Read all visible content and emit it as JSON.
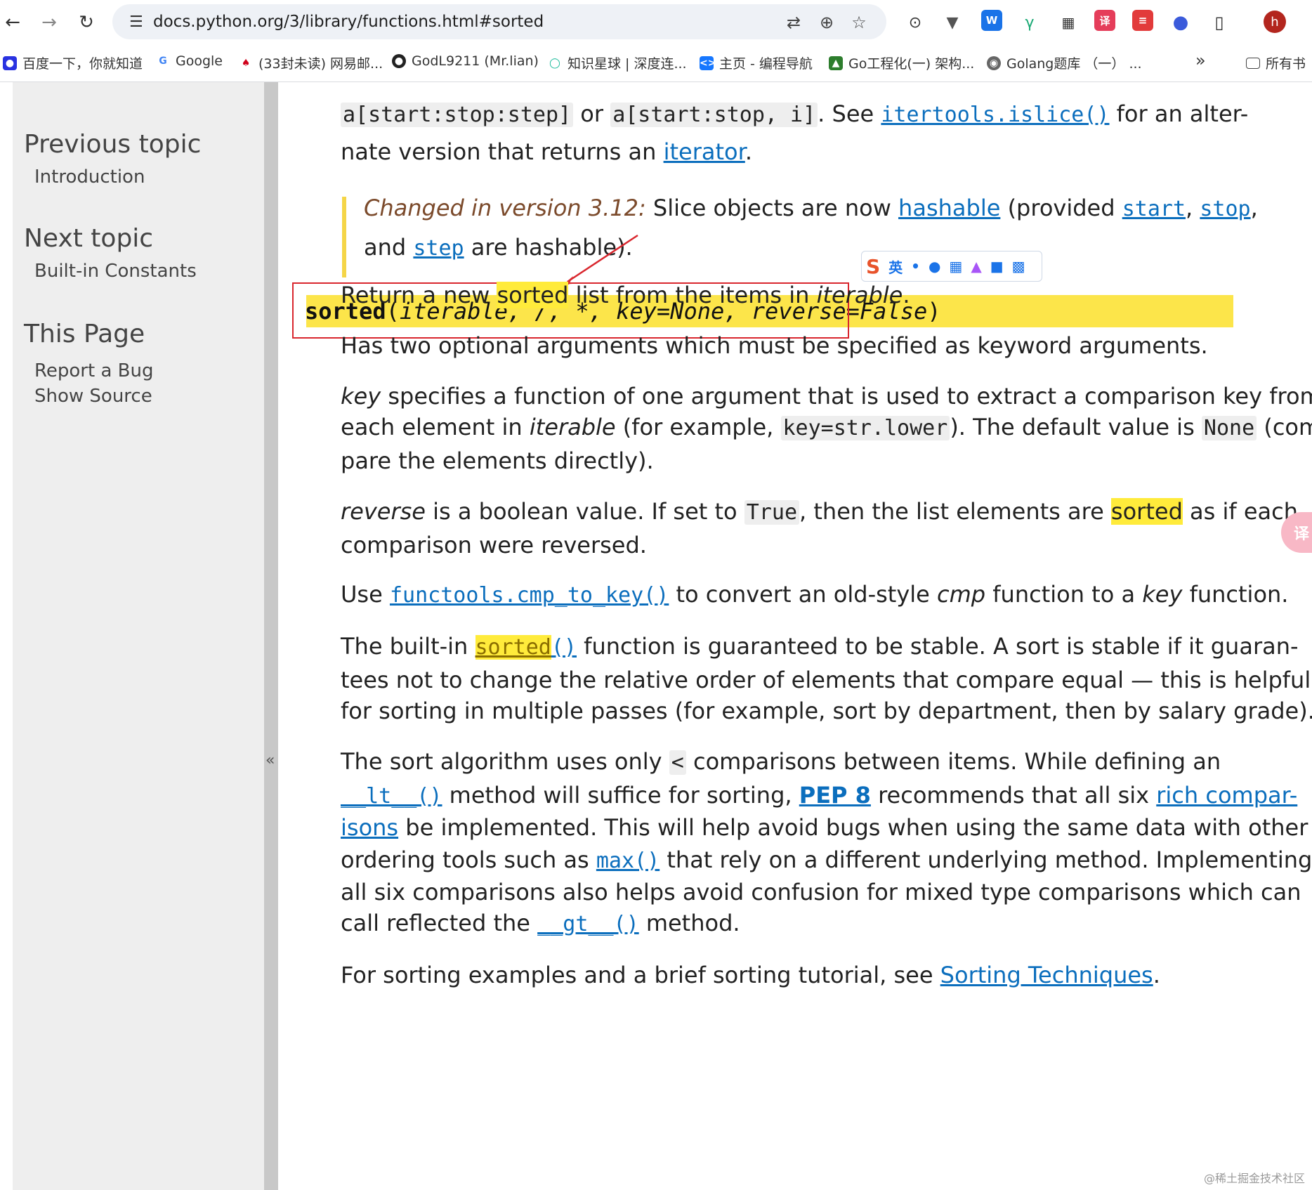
{
  "browser": {
    "url": "docs.python.org/3/library/functions.html#sorted",
    "avatar": "h",
    "ext_labels": [
      "W",
      "译",
      "≡"
    ]
  },
  "bookmarks": [
    {
      "label": "百度一下，你就知道",
      "icon": "baidu-icon",
      "color": "#2932e1"
    },
    {
      "label": "Google",
      "icon": "google-icon",
      "color": "#4285f4"
    },
    {
      "label": "(33封未读) 网易邮...",
      "icon": "netease-mail-icon",
      "color": "#d0021b"
    },
    {
      "label": "GodL9211 (Mr.lian)",
      "icon": "github-icon",
      "color": "#222222"
    },
    {
      "label": "知识星球 | 深度连...",
      "icon": "zsxq-icon",
      "color": "#16b998"
    },
    {
      "label": "主页 - 编程导航",
      "icon": "code-nav-icon",
      "color": "#1677ff"
    },
    {
      "label": "Go工程化(一) 架构...",
      "icon": "go-icon",
      "color": "#2d7d2d"
    },
    {
      "label": "Golang题库 （一） ...",
      "icon": "globe-icon",
      "color": "#666666"
    }
  ],
  "bookmarks_more": "»",
  "bookmarks_all": "所有书",
  "sidebar": {
    "prev_title": "Previous topic",
    "prev_link": "Introduction",
    "next_title": "Next topic",
    "next_link": "Built-in Constants",
    "page_title": "This Page",
    "report_bug": "Report a Bug",
    "show_source": "Show Source",
    "collapse": "«"
  },
  "doc": {
    "slice_a1": "a[start:stop:step]",
    "slice_or": " or ",
    "slice_a2": "a[start:stop, i]",
    "slice_see": ". See ",
    "slice_islice": "itertools.islice()",
    "slice_tail": " for an alter-",
    "slice2_pre": "nate version that returns an ",
    "slice2_link": "iterator",
    "slice2_post": ".",
    "changed_label": "Changed in version 3.12:",
    "changed_pre": " Slice objects are now ",
    "changed_hashable": "hashable",
    "changed_mid": " (provided ",
    "changed_start": "start",
    "changed_comma": ", ",
    "changed_stop": "stop",
    "changed_comma2": ",",
    "changed2_pre": "and ",
    "changed2_step": "step",
    "changed2_post": " are hashable).",
    "sig_name": "sorted",
    "sig_open": "(",
    "sig_params": "iterable, /, *, key=None, reverse=False",
    "sig_close": ")",
    "p1_pre": "Return a new ",
    "p1_hl": "sorted",
    "p1_mid": " list from the items in ",
    "p1_it": "iterable",
    "p1_post": ".",
    "p2": "Has two optional arguments which must be specified as keyword arguments.",
    "p3_key": "key",
    "p3_rest": " specifies a function of one argument that is used to extract a comparison key from",
    "p3b_pre": "each element in ",
    "p3b_it": "iterable",
    "p3b_mid": " (for example, ",
    "p3b_code": "key=str.lower",
    "p3b_mid2": "). The default value is ",
    "p3b_none": "None",
    "p3b_post": " (com-",
    "p3c": "pare the elements directly).",
    "p4_rev": "reverse",
    "p4_mid": " is a boolean value. If set to ",
    "p4_true": "True",
    "p4_mid2": ", then the list elements are ",
    "p4_hl": "sorted",
    "p4_post": " as if each",
    "p4b": "comparison were reversed.",
    "p5_pre": "Use ",
    "p5_link": "functools.cmp_to_key()",
    "p5_mid": " to convert an old-style ",
    "p5_cmp": "cmp",
    "p5_mid2": " function to a ",
    "p5_key": "key",
    "p5_post": " function.",
    "p6_pre": "The built-in ",
    "p6_hl": "sorted",
    "p6_paren": "()",
    "p6_post": " function is guaranteed to be stable. A sort is stable if it guaran-",
    "p6b": "tees not to change the relative order of elements that compare equal — this is helpful",
    "p6c": "for sorting in multiple passes (for example, sort by department, then by salary grade).",
    "p7_pre": "The sort algorithm uses only ",
    "p7_lt": "<",
    "p7_post": " comparisons between items. While defining an",
    "p7b_lt": "__lt__()",
    "p7b_mid": " method will suffice for sorting, ",
    "p7b_pep": "PEP 8",
    "p7b_mid2": " recommends that all six ",
    "p7b_rich": "rich compar-",
    "p7c_isons": "isons",
    "p7c_post": " be implemented. This will help avoid bugs when using the same data with other",
    "p7d_pre": "ordering tools such as ",
    "p7d_max": "max()",
    "p7d_post": " that rely on a different underlying method. Implementing",
    "p7e": "all six comparisons also helps avoid confusion for mixed type comparisons which can",
    "p7f_pre": "call reflected the ",
    "p7f_gt": "__gt__()",
    "p7f_post": " method.",
    "p8_pre": "For sorting examples and a brief sorting tutorial, see ",
    "p8_link": "Sorting Techniques",
    "p8_post": "."
  },
  "ime": {
    "label": "英"
  },
  "side_fab": "译",
  "watermark": "@稀土掘金技术社区"
}
